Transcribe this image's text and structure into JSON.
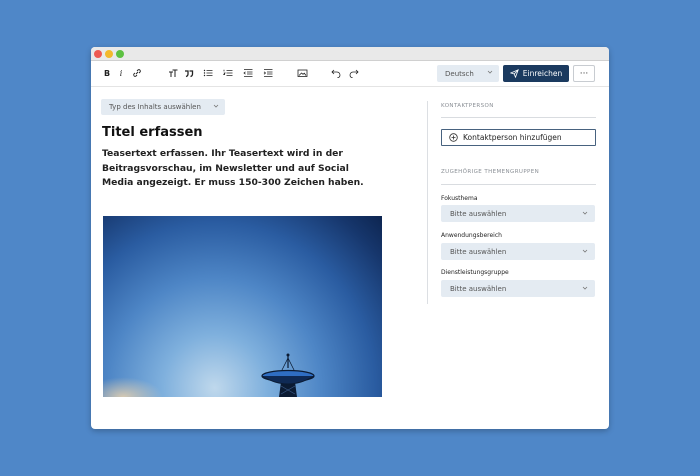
{
  "window": {
    "traffic_lights": [
      "close",
      "minimize",
      "maximize"
    ]
  },
  "toolbar": {
    "bold_label": "B",
    "italic_label": "i",
    "language": "Deutsch",
    "submit_label": "Einreichen",
    "more_label": "···",
    "icons": [
      "bold",
      "italic",
      "link",
      "text-size",
      "quote",
      "bullet-list",
      "numbered-list",
      "outdent",
      "indent",
      "image",
      "undo",
      "redo"
    ]
  },
  "editor": {
    "content_type_placeholder": "Typ des Inhalts auswählen",
    "title": "Titel erfassen",
    "teaser": "Teasertext erfassen. Ihr Teasertext wird in der Beitragsvorschau, im Newsletter und auf Social Media angezeigt. Er muss 150-300 Zeichen haben."
  },
  "sidebar": {
    "contact_section": "KONTAKTPERSON",
    "add_contact": "Kontaktperson hinzufügen",
    "topics_section": "ZUGEHÖRIGE THEMENGRUPPEN",
    "fields": [
      {
        "label": "Fokusthema",
        "value": "Bitte auswählen"
      },
      {
        "label": "Anwendungsbereich",
        "value": "Bitte auswählen"
      },
      {
        "label": "Dienstleistungsgruppe",
        "value": "Bitte auswählen"
      }
    ]
  },
  "colors": {
    "background": "#4f87c8",
    "primary_button": "#1b3a5f",
    "select_bg": "#e4ebf2"
  }
}
